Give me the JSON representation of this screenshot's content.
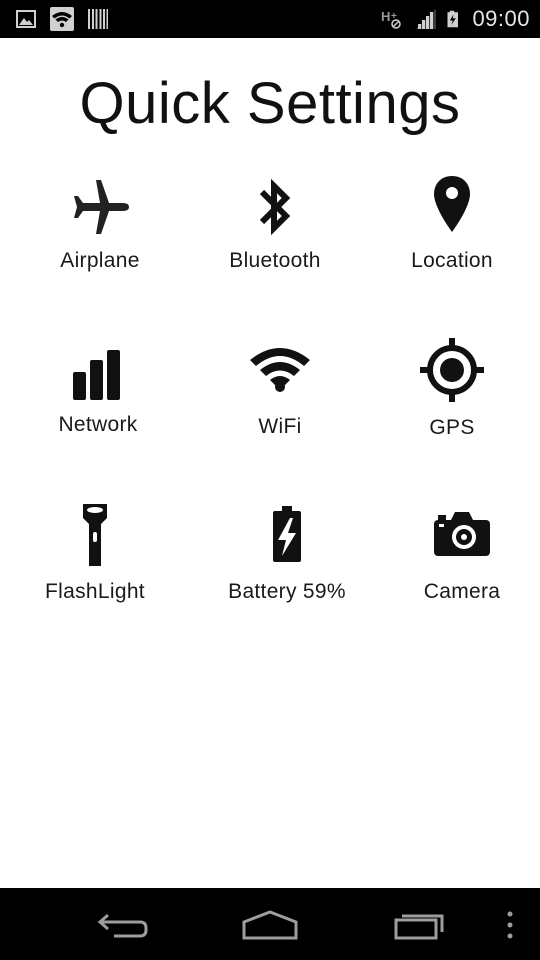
{
  "status_bar": {
    "time": "09:00",
    "left_icons": [
      "gallery-icon",
      "wifi-notification-icon",
      "barcode-icon"
    ],
    "right_icons": [
      "hplus-data-icon",
      "cell-signal-icon",
      "battery-charging-icon"
    ]
  },
  "page": {
    "title": "Quick Settings"
  },
  "tiles": [
    {
      "label": "Airplane",
      "icon": "airplane-icon"
    },
    {
      "label": "Bluetooth",
      "icon": "bluetooth-icon"
    },
    {
      "label": "Location",
      "icon": "location-pin-icon"
    },
    {
      "label": "Network",
      "icon": "network-bars-icon"
    },
    {
      "label": "WiFi",
      "icon": "wifi-icon"
    },
    {
      "label": "GPS",
      "icon": "gps-target-icon"
    },
    {
      "label": "FlashLight",
      "icon": "flashlight-icon"
    },
    {
      "label": "Battery 59%",
      "icon": "battery-charging-icon"
    },
    {
      "label": "Camera",
      "icon": "camera-icon"
    }
  ],
  "nav_bar": {
    "buttons": [
      "back-icon",
      "home-icon",
      "recents-icon",
      "overflow-menu-icon"
    ]
  },
  "colors": {
    "status_bar_bg": "#000000",
    "status_text": "#e6e6e6",
    "page_bg": "#ffffff",
    "icon_color": "#111111",
    "nav_bar_bg": "#000000",
    "nav_icon": "#9e9e9e"
  }
}
